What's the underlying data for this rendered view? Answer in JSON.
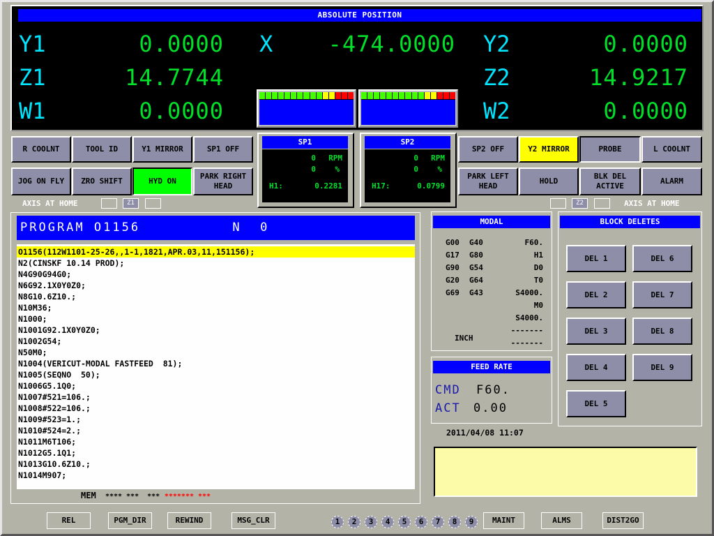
{
  "position": {
    "title": "ABSOLUTE POSITION",
    "axes": [
      {
        "label": "Y1",
        "value": "0.0000"
      },
      {
        "label": "Z1",
        "value": "14.7744"
      },
      {
        "label": "W1",
        "value": "0.0000"
      },
      {
        "label": "X",
        "value": "-474.0000"
      },
      {
        "label": "Y2",
        "value": "0.0000"
      },
      {
        "label": "Z2",
        "value": "14.9217"
      },
      {
        "label": "W2",
        "value": "0.0000"
      }
    ],
    "load_meters": [
      {
        "name": "spindle-1",
        "segments": {
          "green": 10,
          "yellow": 2,
          "red": 3
        },
        "colors": {
          "green": "#44ff00",
          "yellow": "#ffff00",
          "red": "#ff0000"
        }
      },
      {
        "name": "spindle-2",
        "segments": {
          "green": 10,
          "yellow": 2,
          "red": 3
        },
        "colors": {
          "green": "#44ff00",
          "yellow": "#ffff00",
          "red": "#ff0000"
        }
      }
    ]
  },
  "left_buttons": {
    "row1": [
      "R COOLNT",
      "TOOL ID",
      "Y1 MIRROR",
      "SP1 OFF"
    ],
    "row2": [
      "JOG ON FLY",
      "ZRO SHIFT",
      "HYD ON",
      "PARK RIGHT\nHEAD"
    ]
  },
  "right_buttons": {
    "row1": [
      "SP2 OFF",
      "Y2 MIRROR",
      "PROBE",
      "L COOLNT"
    ],
    "row2": [
      "PARK LEFT\nHEAD",
      "HOLD",
      "BLK DEL\nACTIVE",
      "ALARM"
    ]
  },
  "axis_home": {
    "label": "AXIS AT HOME",
    "left_box": "Z1",
    "right_box": "Z2"
  },
  "spindles": [
    {
      "title": "SP1",
      "rpm": "0",
      "rpm_unit": "RPM",
      "percent": "0",
      "percent_unit": "%",
      "h_label": "H1:",
      "h_value": "0.2281"
    },
    {
      "title": "SP2",
      "rpm": "0",
      "rpm_unit": "RPM",
      "percent": "0",
      "percent_unit": "%",
      "h_label": "H17:",
      "h_value": "0.0799"
    }
  ],
  "program": {
    "header": "PROGRAM O1156          N  0",
    "lines": [
      "O1156(112W1101-25-26,,1-1,1821,APR.03,11,151156);",
      "N2(CINSKF 10.14 PROD);",
      "N4G90G94G0;",
      "N6G92.1X0Y0Z0;",
      "N8G10.6Z10.;",
      "N10M36;",
      "N1000;",
      "N1001G92.1X0Y0Z0;",
      "N1002G54;",
      "N50M0;",
      "N1004(VERICUT-MODAL FASTFEED  81);",
      "N1005(SEQNO  50);",
      "N1006G5.1Q0;",
      "N1007#521=106.;",
      "N1008#522=106.;",
      "N1009#523=1.;",
      "N1010#524=2.;",
      "N1011M6T106;",
      "N1012G5.1Q1;",
      "N1013G10.6Z10.;",
      "N1014M907;"
    ],
    "mem_label": "MEM",
    "mem_status": "**** ***  ***",
    "mem_alarm": "******* ***"
  },
  "modal": {
    "title": "MODAL",
    "g_codes": [
      [
        "G00",
        "G40"
      ],
      [
        "G17",
        "G80"
      ],
      [
        "G90",
        "G54"
      ],
      [
        "G20",
        "G64"
      ],
      [
        "G69",
        "G43"
      ]
    ],
    "right_values": [
      "F60.",
      "H1",
      "D0",
      "T0",
      "S4000.",
      "M0",
      "S4000.",
      "-------",
      "-------"
    ],
    "units": "INCH"
  },
  "feed_rate": {
    "title": "FEED RATE",
    "cmd_label": "CMD",
    "cmd_value": "F60.",
    "act_label": "ACT",
    "act_value": "0.00"
  },
  "datetime": "2011/04/08 11:07",
  "block_deletes": {
    "title": "BLOCK DELETES",
    "buttons": [
      "DEL 1",
      "DEL 2",
      "DEL 3",
      "DEL 4",
      "DEL 5",
      "DEL 6",
      "DEL 7",
      "DEL 8",
      "DEL 9"
    ]
  },
  "footer": {
    "left_buttons": [
      "REL",
      "PGM_DIR",
      "REWIND",
      "MSG_CLR"
    ],
    "pages": [
      "1",
      "2",
      "3",
      "4",
      "5",
      "6",
      "7",
      "8",
      "9"
    ],
    "right_buttons": [
      "MAINT",
      "ALMS",
      "DIST2GO"
    ]
  },
  "colors": {
    "background": "#b4b3a8",
    "title_blue": "#0000ff",
    "axis_label": "#00e5ff",
    "axis_value": "#00e02a",
    "button": "#8e8ea8",
    "active_green": "#00ff00",
    "active_yellow": "#ffff00",
    "message_area": "#fcfca8",
    "feed_label": "#1a1aaa",
    "alarm_red": "#ff0000"
  }
}
